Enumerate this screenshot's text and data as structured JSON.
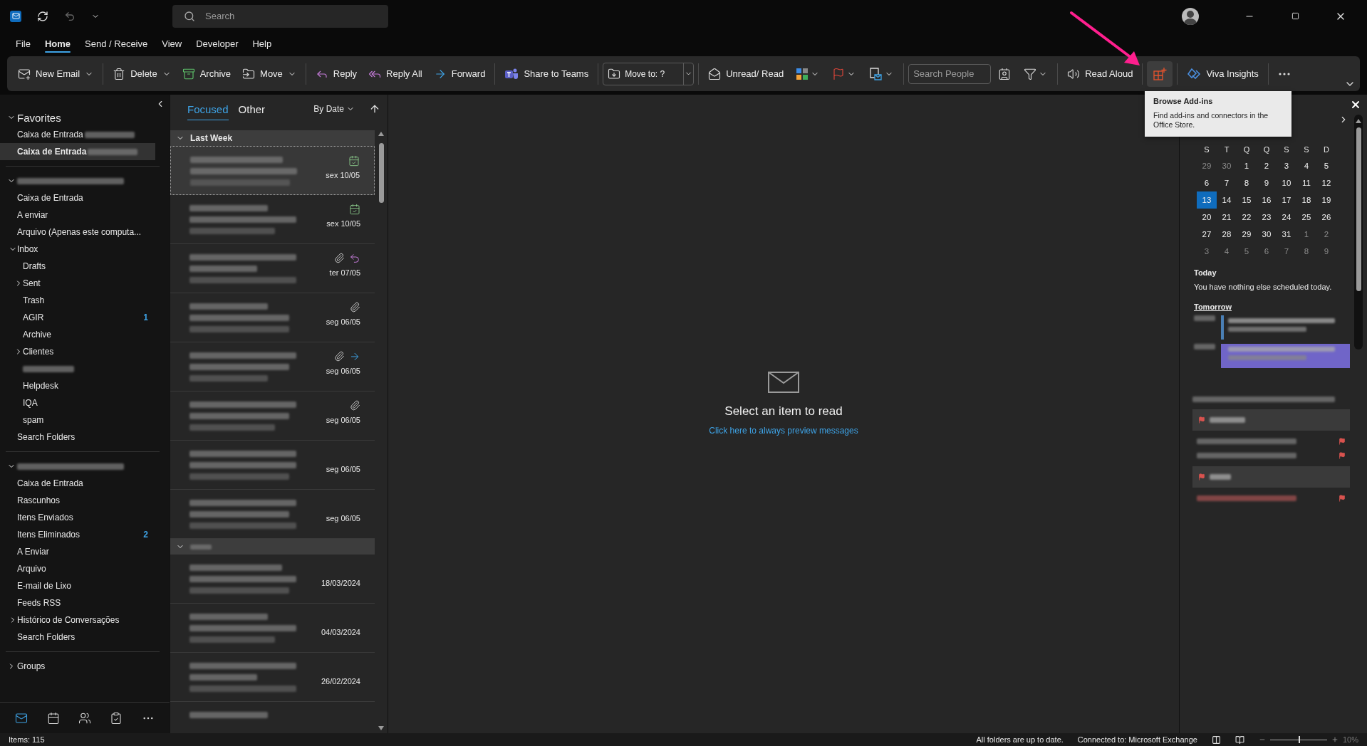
{
  "title_bar": {
    "search_placeholder": "Search"
  },
  "menu_tabs": [
    {
      "label": "File",
      "selected": false
    },
    {
      "label": "Home",
      "selected": true
    },
    {
      "label": "Send / Receive",
      "selected": false
    },
    {
      "label": "View",
      "selected": false
    },
    {
      "label": "Developer",
      "selected": false
    },
    {
      "label": "Help",
      "selected": false
    }
  ],
  "ribbon": [
    {
      "kind": "button",
      "label": "New Email",
      "dropdown": true,
      "hovered": false
    },
    {
      "kind": "separator"
    },
    {
      "kind": "button",
      "label": "Delete",
      "dropdown": true,
      "hovered": false
    },
    {
      "kind": "button",
      "label": "Archive",
      "dropdown": false,
      "hovered": false
    },
    {
      "kind": "button",
      "label": "Move",
      "dropdown": true,
      "hovered": false
    },
    {
      "kind": "separator"
    },
    {
      "kind": "button",
      "label": "Reply",
      "dropdown": false,
      "hovered": false
    },
    {
      "kind": "button",
      "label": "Reply All",
      "dropdown": false,
      "hovered": false
    },
    {
      "kind": "button",
      "label": "Forward",
      "dropdown": false,
      "hovered": false
    },
    {
      "kind": "separator"
    },
    {
      "kind": "button",
      "label": "Share to Teams",
      "dropdown": false,
      "hovered": false
    },
    {
      "kind": "separator"
    },
    {
      "kind": "combo",
      "label": "Move to: ?"
    },
    {
      "kind": "separator"
    },
    {
      "kind": "button",
      "label": "Unread/ Read",
      "dropdown": false,
      "hovered": false
    },
    {
      "kind": "icon",
      "dropdown": true,
      "hovered": false
    },
    {
      "kind": "icon",
      "dropdown": true,
      "hovered": false
    },
    {
      "kind": "icon",
      "dropdown": true,
      "hovered": false
    },
    {
      "kind": "separator"
    },
    {
      "kind": "search",
      "placeholder": "Search People"
    },
    {
      "kind": "icon",
      "dropdown": false,
      "hovered": false
    },
    {
      "kind": "icon",
      "dropdown": true,
      "hovered": false
    },
    {
      "kind": "separator"
    },
    {
      "kind": "button",
      "label": "Read Aloud",
      "dropdown": false,
      "hovered": false
    },
    {
      "kind": "separator"
    },
    {
      "kind": "icon",
      "dropdown": false,
      "hovered": true
    },
    {
      "kind": "separator"
    },
    {
      "kind": "button",
      "label": "Viva Insights",
      "dropdown": false,
      "hovered": false
    },
    {
      "kind": "separator"
    },
    {
      "kind": "icon",
      "dropdown": false,
      "hovered": false
    }
  ],
  "tooltip": {
    "title": "Browse Add-ins",
    "text": "Find add-ins and connectors in the Office Store."
  },
  "folder_pane": {
    "sections": [
      {
        "label": "Favorites",
        "redacted": false,
        "expanded": true,
        "items": [
          {
            "label": "Caixa de Entrada",
            "redacted_suffix": true,
            "selected": false
          },
          {
            "label": "Caixa de Entrada",
            "redacted_suffix": true,
            "selected": true
          }
        ]
      },
      {
        "redacted": true,
        "expanded": true,
        "items": [
          {
            "label": "Caixa de Entrada",
            "selected": false
          },
          {
            "label": "A enviar",
            "selected": false
          },
          {
            "label": "Arquivo (Apenas este computa...",
            "selected": false
          },
          {
            "label": "Inbox",
            "selected": false,
            "expanded": true,
            "children": [
              {
                "label": "Drafts",
                "selected": false
              },
              {
                "label": "Sent",
                "selected": false,
                "expanded": false
              },
              {
                "label": "Trash",
                "selected": false
              },
              {
                "label": "AGIR",
                "selected": false,
                "count": "1"
              },
              {
                "label": "Archive",
                "selected": false
              },
              {
                "label": "Clientes",
                "selected": false,
                "expanded": false
              },
              {
                "redacted": true,
                "selected": false
              },
              {
                "label": "Helpdesk",
                "selected": false
              },
              {
                "label": "IQA",
                "selected": false
              },
              {
                "label": "spam",
                "selected": false
              }
            ]
          },
          {
            "label": "Search Folders",
            "selected": false
          }
        ]
      },
      {
        "redacted": true,
        "expanded": true,
        "items": [
          {
            "label": "Caixa de Entrada",
            "selected": false
          },
          {
            "label": "Rascunhos",
            "selected": false
          },
          {
            "label": "Itens Enviados",
            "selected": false
          },
          {
            "label": "Itens Eliminados",
            "selected": false,
            "count": "2"
          },
          {
            "label": "A Enviar",
            "selected": false
          },
          {
            "label": "Arquivo",
            "selected": false
          },
          {
            "label": "E-mail de Lixo",
            "selected": false
          },
          {
            "label": "Feeds RSS",
            "selected": false
          },
          {
            "label": "Histórico de Conversações",
            "selected": false,
            "expanded": false
          },
          {
            "label": "Search Folders",
            "selected": false
          }
        ]
      },
      {
        "label": "Groups",
        "redacted": false,
        "expanded": false
      }
    ]
  },
  "nav": [
    {
      "selected": true
    },
    {
      "selected": false
    },
    {
      "selected": false
    },
    {
      "selected": false
    },
    {
      "selected": false
    }
  ],
  "message_list": {
    "tabs": [
      {
        "label": "Focused",
        "selected": true
      },
      {
        "label": "Other",
        "selected": false
      }
    ],
    "sort": "By Date",
    "groups": [
      {
        "label": "Last Week",
        "redacted": false,
        "expanded": true,
        "messages": [
          {
            "kind": "meeting",
            "selected": true,
            "attachment": false,
            "date": "sex 10/05"
          },
          {
            "kind": "meeting",
            "selected": false,
            "attachment": false,
            "date": "sex 10/05"
          },
          {
            "kind": "replied",
            "selected": false,
            "attachment": true,
            "date": "ter 07/05"
          },
          {
            "kind": "plain",
            "selected": false,
            "attachment": true,
            "date": "seg 06/05"
          },
          {
            "kind": "forwarded",
            "selected": false,
            "attachment": true,
            "date": "seg 06/05"
          },
          {
            "kind": "plain",
            "selected": false,
            "attachment": true,
            "date": "seg 06/05"
          },
          {
            "kind": "plain",
            "selected": false,
            "attachment": false,
            "date": "seg 06/05"
          },
          {
            "kind": "plain",
            "selected": false,
            "attachment": false,
            "date": "seg 06/05"
          }
        ]
      },
      {
        "redacted": true,
        "expanded": true,
        "messages": [
          {
            "kind": "plain",
            "selected": false,
            "attachment": false,
            "date": "18/03/2024"
          },
          {
            "kind": "plain",
            "selected": false,
            "attachment": false,
            "date": "04/03/2024"
          },
          {
            "kind": "plain",
            "selected": false,
            "attachment": false,
            "date": "26/02/2024"
          },
          {
            "kind": "plain",
            "selected": false,
            "attachment": false
          }
        ]
      }
    ]
  },
  "reading_pane": {
    "message": "Select an item to read",
    "link": "Click here to always preview messages"
  },
  "todo_bar": {
    "weekdays": [
      "S",
      "T",
      "Q",
      "Q",
      "S",
      "S",
      "D"
    ],
    "weeks": [
      [
        {
          "day": "29",
          "muted": true,
          "selected": false
        },
        {
          "day": "30",
          "muted": true,
          "selected": false
        },
        {
          "day": "1",
          "muted": false,
          "selected": false
        },
        {
          "day": "2",
          "muted": false,
          "selected": false
        },
        {
          "day": "3",
          "muted": false,
          "selected": false
        },
        {
          "day": "4",
          "muted": false,
          "selected": false
        },
        {
          "day": "5",
          "muted": false,
          "selected": false
        }
      ],
      [
        {
          "day": "6",
          "muted": false,
          "selected": false
        },
        {
          "day": "7",
          "muted": false,
          "selected": false
        },
        {
          "day": "8",
          "muted": false,
          "selected": false
        },
        {
          "day": "9",
          "muted": false,
          "selected": false
        },
        {
          "day": "10",
          "muted": false,
          "selected": false
        },
        {
          "day": "11",
          "muted": false,
          "selected": false
        },
        {
          "day": "12",
          "muted": false,
          "selected": false
        }
      ],
      [
        {
          "day": "13",
          "muted": false,
          "selected": true
        },
        {
          "day": "14",
          "muted": false,
          "selected": false
        },
        {
          "day": "15",
          "muted": false,
          "selected": false
        },
        {
          "day": "16",
          "muted": false,
          "selected": false
        },
        {
          "day": "17",
          "muted": false,
          "selected": false
        },
        {
          "day": "18",
          "muted": false,
          "selected": false
        },
        {
          "day": "19",
          "muted": false,
          "selected": false
        }
      ],
      [
        {
          "day": "20",
          "muted": false,
          "selected": false
        },
        {
          "day": "21",
          "muted": false,
          "selected": false
        },
        {
          "day": "22",
          "muted": false,
          "selected": false
        },
        {
          "day": "23",
          "muted": false,
          "selected": false
        },
        {
          "day": "24",
          "muted": false,
          "selected": false
        },
        {
          "day": "25",
          "muted": false,
          "selected": false
        },
        {
          "day": "26",
          "muted": false,
          "selected": false
        }
      ],
      [
        {
          "day": "27",
          "muted": false,
          "selected": false
        },
        {
          "day": "28",
          "muted": false,
          "selected": false
        },
        {
          "day": "29",
          "muted": false,
          "selected": false
        },
        {
          "day": "30",
          "muted": false,
          "selected": false
        },
        {
          "day": "31",
          "muted": false,
          "selected": false
        },
        {
          "day": "1",
          "muted": true,
          "selected": false
        },
        {
          "day": "2",
          "muted": true,
          "selected": false
        }
      ],
      [
        {
          "day": "3",
          "muted": true,
          "selected": false
        },
        {
          "day": "4",
          "muted": true,
          "selected": false
        },
        {
          "day": "5",
          "muted": true,
          "selected": false
        },
        {
          "day": "6",
          "muted": true,
          "selected": false
        },
        {
          "day": "7",
          "muted": true,
          "selected": false
        },
        {
          "day": "8",
          "muted": true,
          "selected": false
        },
        {
          "day": "9",
          "muted": true,
          "selected": false
        }
      ]
    ],
    "today_label": "Today",
    "today_text": "You have nothing else scheduled today.",
    "tomorrow_label": "Tomorrow",
    "events": [
      {
        "color": "#4a7fb5"
      },
      {
        "color": "#7065c8"
      }
    ]
  },
  "status_bar": {
    "items": "Items: 115",
    "sync": "All folders are up to date.",
    "connection": "Connected to: Microsoft Exchange",
    "zoom": {
      "level": 0.5,
      "reading": "10%"
    }
  }
}
